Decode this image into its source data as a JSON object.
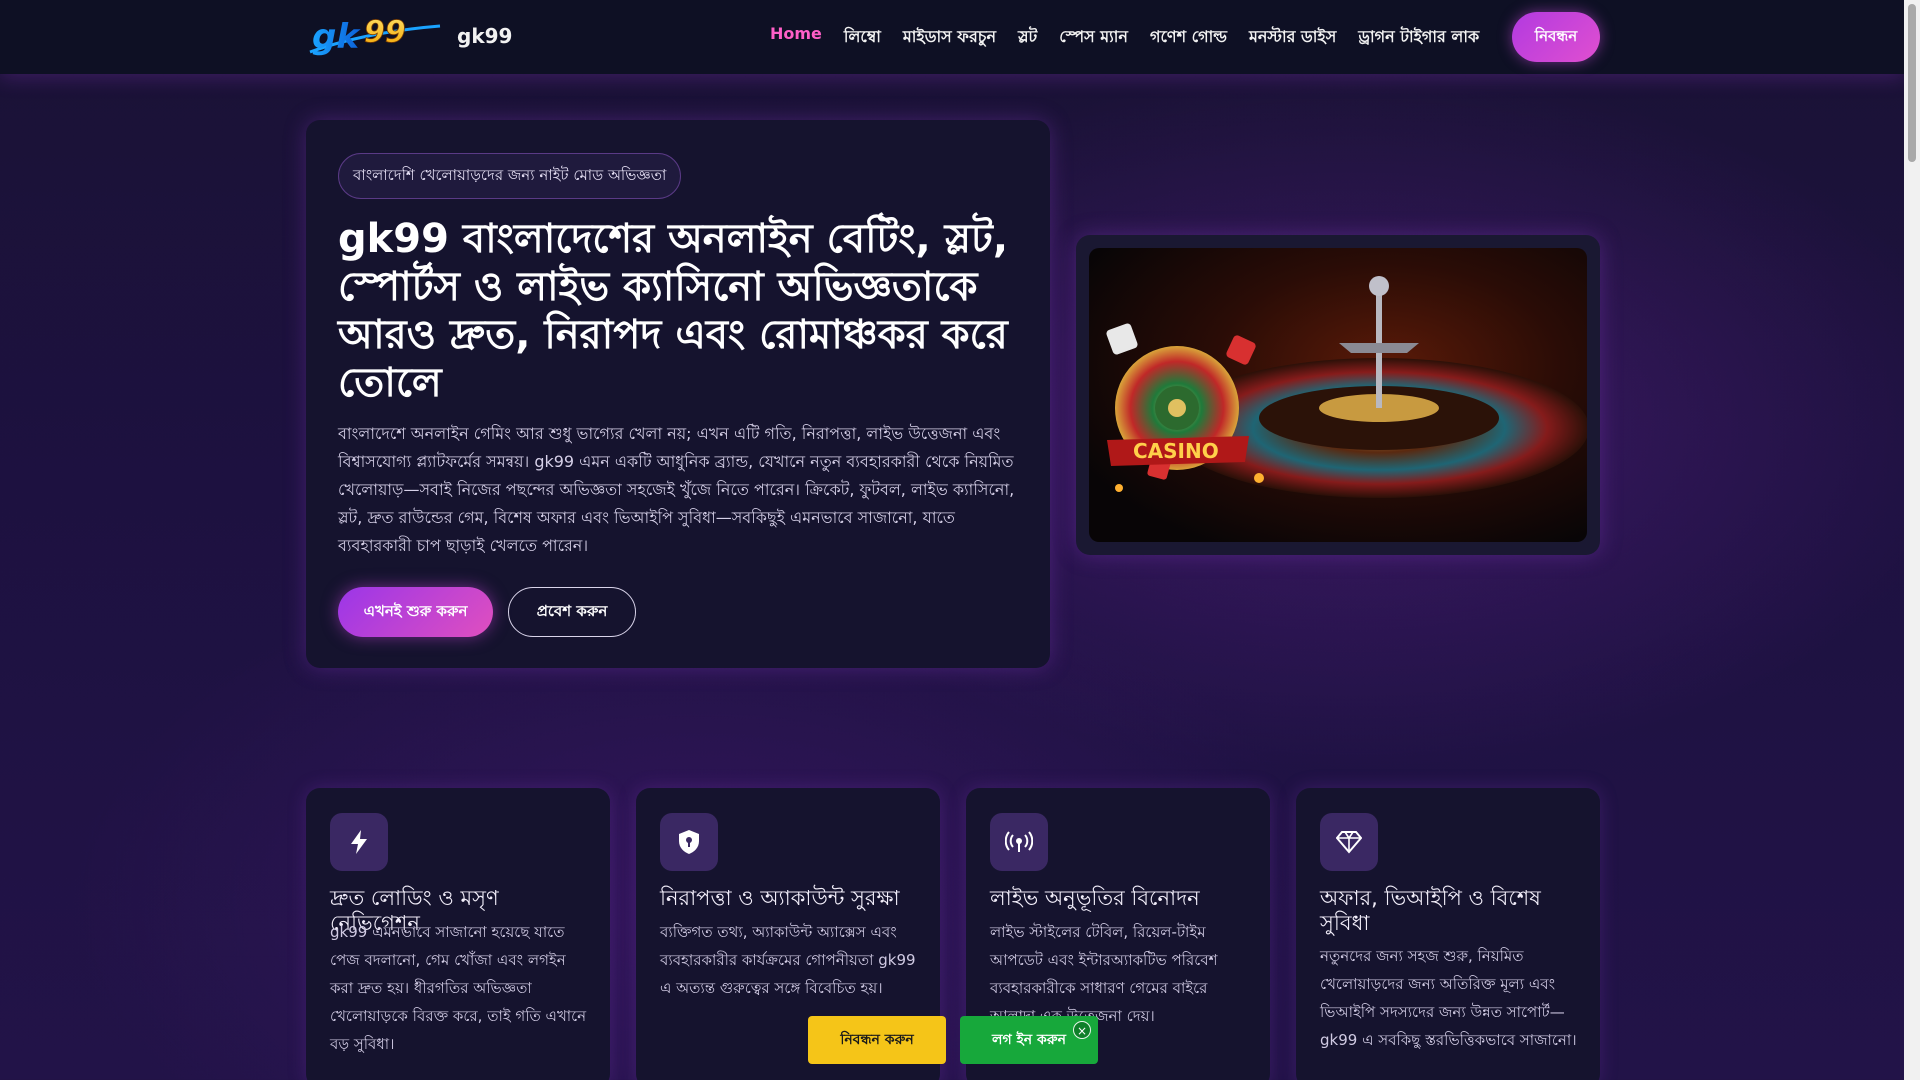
{
  "header": {
    "site_name": "gk99",
    "nav": [
      {
        "label": "Home",
        "active": true
      },
      {
        "label": "লিম্বো"
      },
      {
        "label": "মাইডাস ফরচুন"
      },
      {
        "label": "স্লট"
      },
      {
        "label": "স্পেস ম্যান"
      },
      {
        "label": "গণেশ গোল্ড"
      },
      {
        "label": "মনস্টার ডাইস"
      },
      {
        "label": "ড্রাগন টাইগার লাক"
      }
    ],
    "register_label": "নিবন্ধন"
  },
  "hero": {
    "badge": "বাংলাদেশি খেলোয়াড়দের জন্য নাইট মোড অভিজ্ঞতা",
    "title": "gk99 বাংলাদেশের অনলাইন বেটিং, স্লট, স্পোর্টস ও লাইভ ক্যাসিনো অভিজ্ঞতাকে আরও দ্রুত, নিরাপদ এবং রোমাঞ্চকর করে তোলে",
    "description": "বাংলাদেশে অনলাইন গেমিং আর শুধু ভাগ্যের খেলা নয়; এখন এটি গতি, নিরাপত্তা, লাইভ উত্তেজনা এবং বিশ্বাসযোগ্য প্ল্যাটফর্মের সমন্বয়। gk99 এমন একটি আধুনিক ব্র্যান্ড, যেখানে নতুন ব্যবহারকারী থেকে নিয়মিত খেলোয়াড়—সবাই নিজের পছন্দের অভিজ্ঞতা সহজেই খুঁজে নিতে পারেন। ক্রিকেট, ফুটবল, লাইভ ক্যাসিনো, স্লট, দ্রুত রাউন্ডের গেম, বিশেষ অফার এবং ভিআইপি সুবিধা—সবকিছুই এমনভাবে সাজানো, যাতে ব্যবহারকারী চাপ ছাড়াই খেলতে পারেন।",
    "start_button": "এখনই শুরু করুন",
    "login_button": "প্রবেশ করুন",
    "image_text": "CASINO"
  },
  "features": [
    {
      "icon": "lightning-icon",
      "title": "দ্রুত লোডিং ও মসৃণ নেভিগেশন",
      "text": "gk99 এমনভাবে সাজানো হয়েছে যাতে পেজ বদলানো, গেম খোঁজা এবং লগইন করা দ্রুত হয়। ধীরগতির অভিজ্ঞতা খেলোয়াড়কে বিরক্ত করে, তাই গতি এখানে বড় সুবিধা।"
    },
    {
      "icon": "shield-lock-icon",
      "title": "নিরাপত্তা ও অ্যাকাউন্ট সুরক্ষা",
      "text": "ব্যক্তিগত তথ্য, অ্যাকাউন্ট অ্যাক্সেস এবং ব্যবহারকারীর কার্যক্রমের গোপনীয়তা gk99 এ অত্যন্ত গুরুত্বের সঙ্গে বিবেচিত হয়।"
    },
    {
      "icon": "broadcast-icon",
      "title": "লাইভ অনুভূতির বিনোদন",
      "text": "লাইভ স্টাইলের টেবিল, রিয়েল-টাইম আপডেট এবং ইন্টারঅ্যাকটিভ পরিবেশ ব্যবহারকারীকে সাধারণ গেমের বাইরে আলাদা এক উত্তেজনা দেয়।"
    },
    {
      "icon": "diamond-icon",
      "title": "অফার, ভিআইপি ও বিশেষ সুবিধা",
      "text": "নতুনদের জন্য সহজ শুরু, নিয়মিত খেলোয়াড়দের জন্য অতিরিক্ত মূল্য এবং ভিআইপি সদস্যদের জন্য উন্নত সাপোর্ট—gk99 এ সবকিছু স্তরভিত্তিকভাবে সাজানো।"
    }
  ],
  "sticky": {
    "register_label": "নিবন্ধন করুন",
    "login_label": "লগ ইন করুন",
    "close_label": "×"
  }
}
